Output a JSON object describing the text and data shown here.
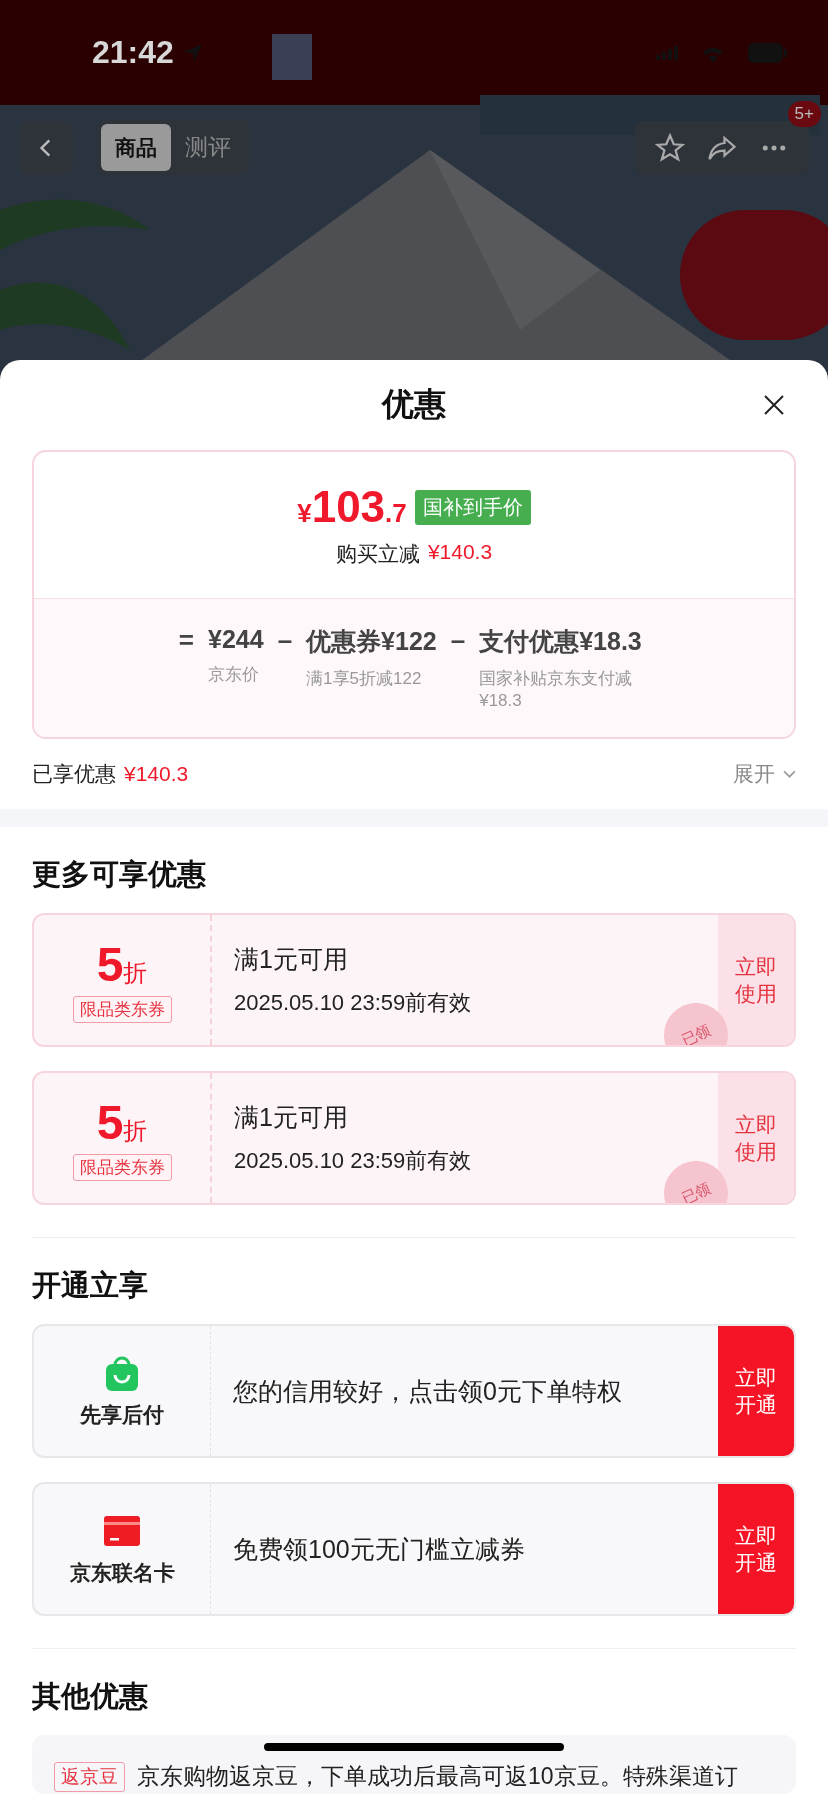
{
  "status_bar": {
    "time": "21:42"
  },
  "nav": {
    "tabs": [
      {
        "label": "商品",
        "selected": true
      },
      {
        "label": "测评",
        "selected": false
      }
    ],
    "badge": "5+"
  },
  "sheet": {
    "title": "优惠",
    "price": {
      "currency": "¥",
      "integer": "103",
      "decimal": ".7",
      "tag": "国补到手价",
      "saving_label": "购买立减",
      "saving": "¥140.3",
      "breakdown": [
        {
          "op": "=",
          "amount": "¥244",
          "note": "京东价"
        },
        {
          "op": "–",
          "amount": "优惠券¥122",
          "note": "满1享5折减122"
        },
        {
          "op": "–",
          "amount": "支付优惠¥18.3",
          "note": "国家补贴京东支付减¥18.3"
        }
      ]
    },
    "enjoyed": {
      "label": "已享优惠",
      "amount": "¥140.3",
      "expand": "展开"
    },
    "more": {
      "title": "更多可享优惠",
      "coupons": [
        {
          "value": "5",
          "unit": "折",
          "tag": "限品类东券",
          "title": "满1元可用",
          "expiry": "2025.05.10 23:59前有效",
          "action": "立即使用",
          "stamp": "已领"
        },
        {
          "value": "5",
          "unit": "折",
          "tag": "限品类东券",
          "title": "满1元可用",
          "expiry": "2025.05.10 23:59前有效",
          "action": "立即使用",
          "stamp": "已领"
        }
      ]
    },
    "open": {
      "title": "开通立享",
      "items": [
        {
          "kind": "bag",
          "name": "先享后付",
          "desc": "您的信用较好，点击领0元下单特权",
          "action": "立即开通"
        },
        {
          "kind": "card",
          "name": "京东联名卡",
          "desc": "免费领100元无门槛立减券",
          "action": "立即开通"
        }
      ]
    },
    "other": {
      "title": "其他优惠",
      "items": [
        {
          "tag": "返京豆",
          "text": "京东购物返京豆，下单成功后最高可返10京豆。特殊渠道订"
        }
      ]
    }
  }
}
